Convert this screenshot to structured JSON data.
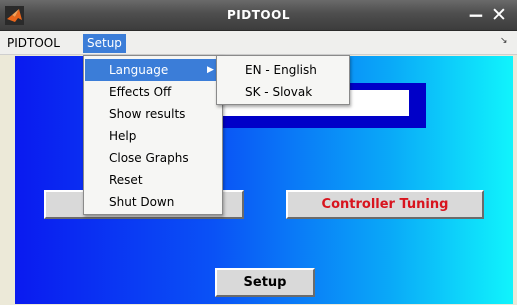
{
  "window": {
    "title": "PIDTOOL",
    "minimize_glyph": "−",
    "close_glyph": "✕"
  },
  "menubar": {
    "items": [
      {
        "label": "PIDTOOL"
      },
      {
        "label": "Setup",
        "active": true
      }
    ],
    "corner_glyph": "↘"
  },
  "setup_menu": {
    "items": [
      {
        "label": "Language",
        "has_submenu": true,
        "highlighted": true
      },
      {
        "label": "Effects Off"
      },
      {
        "label": "Show results"
      },
      {
        "label": "Help"
      },
      {
        "label": "Close Graphs"
      },
      {
        "label": "Reset"
      },
      {
        "label": "Shut Down"
      }
    ],
    "submenu_arrow": "▶"
  },
  "language_submenu": {
    "items": [
      {
        "label": "EN - English"
      },
      {
        "label": "SK - Slovak"
      }
    ]
  },
  "figure": {
    "buttons": {
      "left_label": "",
      "tuning_label": "Controller Tuning",
      "setup_label": "Setup"
    }
  },
  "colors": {
    "menu_highlight": "#3b7dd8",
    "tuning_text": "#d8141e",
    "panel_border": "#0000c8",
    "gradient_start": "#0a1af0",
    "gradient_end": "#10f4fc"
  },
  "icons": {
    "app": "matlab-icon"
  }
}
